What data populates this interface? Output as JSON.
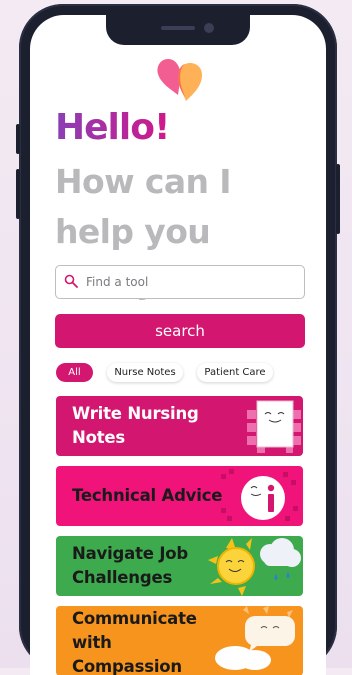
{
  "greeting": "Hello!",
  "subtitle": "How can I help you today?",
  "search": {
    "placeholder": "Find a tool",
    "button_label": "search"
  },
  "filters": [
    "All",
    "Nurse Notes",
    "Patient Care"
  ],
  "active_filter": "All",
  "tools": [
    {
      "label": "Write Nursing Notes",
      "color": "#d3166f",
      "text_color": "#ffffff",
      "icon": "notepad-icon"
    },
    {
      "label": "Technical Advice",
      "color": "#f0137a",
      "text_color": "#1a1a1a",
      "icon": "info-icon"
    },
    {
      "label": "Navigate Job Challenges",
      "color": "#3daa4e",
      "text_color": "#1a1a1a",
      "icon": "sun-cloud-icon"
    },
    {
      "label": "Communicate with Compassion",
      "color": "#f7941d",
      "text_color": "#1a1a1a",
      "icon": "chat-bubbles-icon"
    }
  ],
  "colors": {
    "accent": "#d3166f",
    "greeting_gradient": [
      "#8b3fb5",
      "#d0188a"
    ]
  }
}
